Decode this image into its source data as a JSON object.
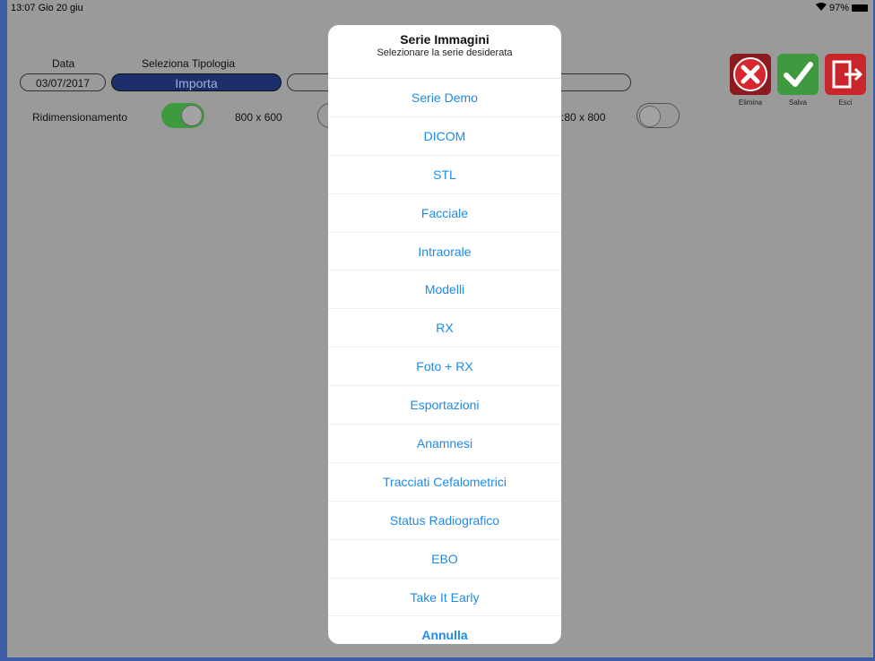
{
  "statusbar": {
    "time": "13:07  Gio 20 giu",
    "battery": "97%"
  },
  "form": {
    "data_label": "Data",
    "tipologia_label": "Seleziona Tipologia",
    "date_value": "03/07/2017",
    "importa_label": "Importa",
    "ridimensionamento_label": "Ridimensionamento",
    "size1_label": "800 x 600",
    "size2_label": ":80 x 800"
  },
  "actions": {
    "elimina": "Elimina",
    "salva": "Salva",
    "esci": "Esci",
    "colors": {
      "elimina": "#c9252c",
      "salva": "#4aa64a",
      "esci": "#d12a2a"
    }
  },
  "sheet": {
    "title": "Serie Immagini",
    "subtitle": "Selezionare la serie desiderata",
    "options": [
      "Serie Demo",
      "DICOM",
      "STL",
      "Facciale",
      "Intraorale",
      "Modelli",
      "RX",
      "Foto + RX",
      "Esportazioni",
      "Anamnesi",
      "Tracciati Cefalometrici",
      "Status Radiografico",
      "EBO",
      "Take It Early"
    ],
    "cancel": "Annulla",
    "accent": "#1e8be8"
  }
}
